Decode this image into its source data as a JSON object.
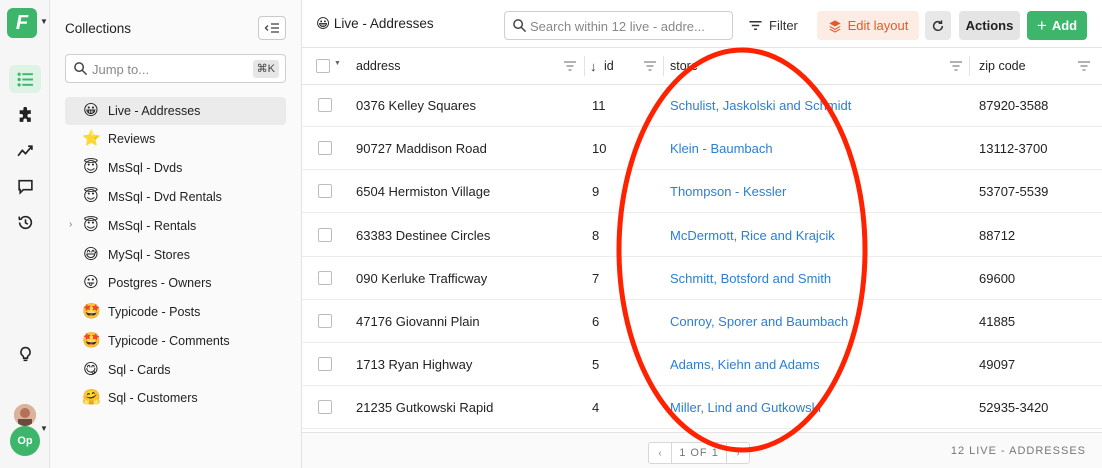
{
  "rail": {
    "logo_letter": "F",
    "avatar_initials": "Op"
  },
  "sidebar": {
    "title": "Collections",
    "jump_placeholder": "Jump to...",
    "jump_shortcut": "⌘K",
    "items": [
      {
        "label": "Live - Addresses",
        "emoji": "😀"
      },
      {
        "label": "Reviews",
        "emoji": "⭐"
      },
      {
        "label": "MsSql - Dvds",
        "emoji": "😇"
      },
      {
        "label": "MsSql - Dvd Rentals",
        "emoji": "😇"
      },
      {
        "label": "MsSql - Rentals",
        "emoji": "😇"
      },
      {
        "label": "MySql - Stores",
        "emoji": "😅"
      },
      {
        "label": "Postgres - Owners",
        "emoji": "😛"
      },
      {
        "label": "Typicode - Posts",
        "emoji": "🤩"
      },
      {
        "label": "Typicode - Comments",
        "emoji": "🤩"
      },
      {
        "label": "Sql - Cards",
        "emoji": "😋"
      },
      {
        "label": "Sql - Customers",
        "emoji": "🤗"
      }
    ]
  },
  "header": {
    "emoji": "😀",
    "title": "Live - Addresses",
    "search_placeholder": "Search within 12 live - addre...",
    "filter_label": "Filter",
    "edit_layout_label": "Edit layout",
    "actions_label": "Actions",
    "add_label": "Add"
  },
  "table": {
    "columns": [
      "address",
      "id",
      "store",
      "zip code"
    ],
    "rows": [
      {
        "address": "0376 Kelley Squares",
        "id": "11",
        "store": "Schulist, Jaskolski and Schmidt",
        "zip": "87920-3588"
      },
      {
        "address": "90727 Maddison Road",
        "id": "10",
        "store": "Klein - Baumbach",
        "zip": "13112-3700"
      },
      {
        "address": "6504 Hermiston Village",
        "id": "9",
        "store": "Thompson - Kessler",
        "zip": "53707-5539"
      },
      {
        "address": "63383 Destinee Circles",
        "id": "8",
        "store": "McDermott, Rice and Krajcik",
        "zip": "88712"
      },
      {
        "address": "090 Kerluke Trafficway",
        "id": "7",
        "store": "Schmitt, Botsford and Smith",
        "zip": "69600"
      },
      {
        "address": "47176 Giovanni Plain",
        "id": "6",
        "store": "Conroy, Sporer and Baumbach",
        "zip": "41885"
      },
      {
        "address": "1713 Ryan Highway",
        "id": "5",
        "store": "Adams, Kiehn and Adams",
        "zip": "49097"
      },
      {
        "address": "21235 Gutkowski Rapid",
        "id": "4",
        "store": "Miller, Lind and Gutkowski",
        "zip": "52935-3420"
      }
    ]
  },
  "footer": {
    "page_text": "1 OF 1",
    "record_count": "12 LIVE - ADDRESSES"
  },
  "colors": {
    "brand": "#3db56b",
    "link": "#2a7fd4",
    "edit_layout": "#e35a2c",
    "annotation": "#ff2200"
  }
}
